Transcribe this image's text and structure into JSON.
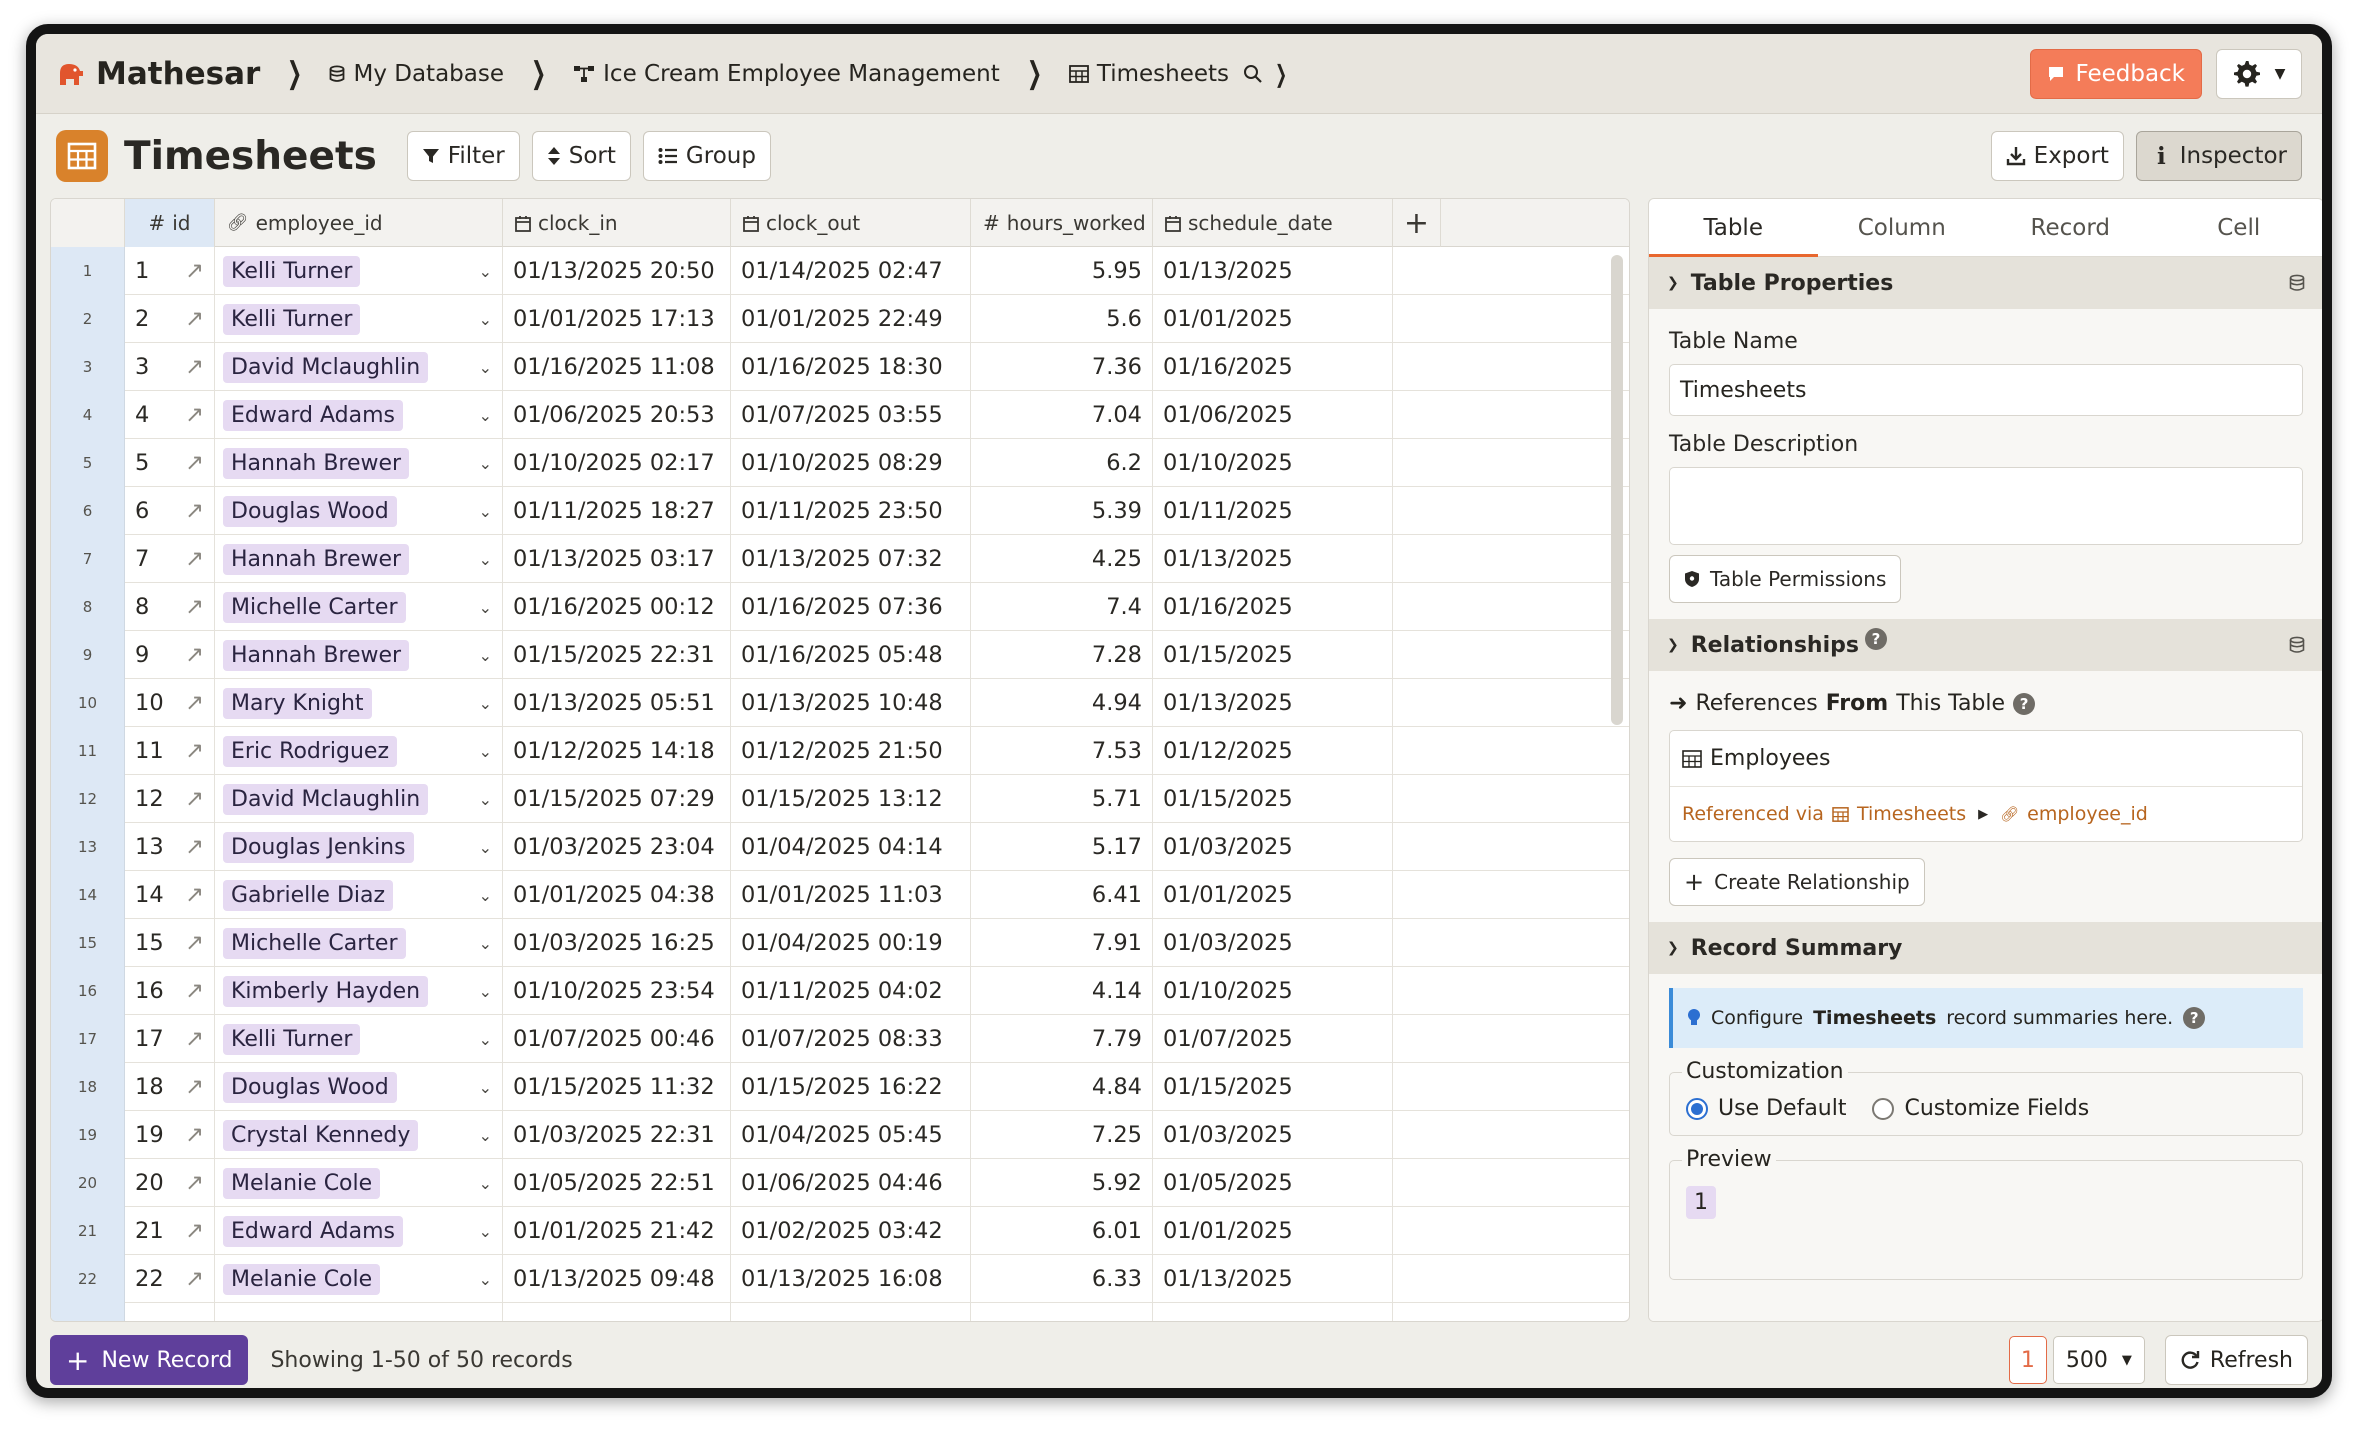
{
  "app": {
    "name": "Mathesar"
  },
  "breadcrumbs": [
    {
      "label": "My Database"
    },
    {
      "label": "Ice Cream Employee Management"
    },
    {
      "label": "Timesheets"
    }
  ],
  "header": {
    "feedback_label": "Feedback"
  },
  "title_bar": {
    "title": "Timesheets",
    "filter_label": "Filter",
    "sort_label": "Sort",
    "group_label": "Group",
    "export_label": "Export",
    "inspector_label": "Inspector"
  },
  "grid": {
    "columns": [
      "id",
      "employee_id",
      "clock_in",
      "clock_out",
      "hours_worked",
      "schedule_date"
    ],
    "rows": [
      {
        "n": "1",
        "id": "1",
        "emp": "Kelli Turner",
        "in": "01/13/2025 20:50",
        "out": "01/14/2025 02:47",
        "hrs": "5.95",
        "date": "01/13/2025"
      },
      {
        "n": "2",
        "id": "2",
        "emp": "Kelli Turner",
        "in": "01/01/2025 17:13",
        "out": "01/01/2025 22:49",
        "hrs": "5.6",
        "date": "01/01/2025"
      },
      {
        "n": "3",
        "id": "3",
        "emp": "David Mclaughlin",
        "in": "01/16/2025 11:08",
        "out": "01/16/2025 18:30",
        "hrs": "7.36",
        "date": "01/16/2025"
      },
      {
        "n": "4",
        "id": "4",
        "emp": "Edward Adams",
        "in": "01/06/2025 20:53",
        "out": "01/07/2025 03:55",
        "hrs": "7.04",
        "date": "01/06/2025"
      },
      {
        "n": "5",
        "id": "5",
        "emp": "Hannah Brewer",
        "in": "01/10/2025 02:17",
        "out": "01/10/2025 08:29",
        "hrs": "6.2",
        "date": "01/10/2025"
      },
      {
        "n": "6",
        "id": "6",
        "emp": "Douglas Wood",
        "in": "01/11/2025 18:27",
        "out": "01/11/2025 23:50",
        "hrs": "5.39",
        "date": "01/11/2025"
      },
      {
        "n": "7",
        "id": "7",
        "emp": "Hannah Brewer",
        "in": "01/13/2025 03:17",
        "out": "01/13/2025 07:32",
        "hrs": "4.25",
        "date": "01/13/2025"
      },
      {
        "n": "8",
        "id": "8",
        "emp": "Michelle Carter",
        "in": "01/16/2025 00:12",
        "out": "01/16/2025 07:36",
        "hrs": "7.4",
        "date": "01/16/2025"
      },
      {
        "n": "9",
        "id": "9",
        "emp": "Hannah Brewer",
        "in": "01/15/2025 22:31",
        "out": "01/16/2025 05:48",
        "hrs": "7.28",
        "date": "01/15/2025"
      },
      {
        "n": "10",
        "id": "10",
        "emp": "Mary Knight",
        "in": "01/13/2025 05:51",
        "out": "01/13/2025 10:48",
        "hrs": "4.94",
        "date": "01/13/2025"
      },
      {
        "n": "11",
        "id": "11",
        "emp": "Eric Rodriguez",
        "in": "01/12/2025 14:18",
        "out": "01/12/2025 21:50",
        "hrs": "7.53",
        "date": "01/12/2025"
      },
      {
        "n": "12",
        "id": "12",
        "emp": "David Mclaughlin",
        "in": "01/15/2025 07:29",
        "out": "01/15/2025 13:12",
        "hrs": "5.71",
        "date": "01/15/2025"
      },
      {
        "n": "13",
        "id": "13",
        "emp": "Douglas Jenkins",
        "in": "01/03/2025 23:04",
        "out": "01/04/2025 04:14",
        "hrs": "5.17",
        "date": "01/03/2025"
      },
      {
        "n": "14",
        "id": "14",
        "emp": "Gabrielle Diaz",
        "in": "01/01/2025 04:38",
        "out": "01/01/2025 11:03",
        "hrs": "6.41",
        "date": "01/01/2025"
      },
      {
        "n": "15",
        "id": "15",
        "emp": "Michelle Carter",
        "in": "01/03/2025 16:25",
        "out": "01/04/2025 00:19",
        "hrs": "7.91",
        "date": "01/03/2025"
      },
      {
        "n": "16",
        "id": "16",
        "emp": "Kimberly Hayden",
        "in": "01/10/2025 23:54",
        "out": "01/11/2025 04:02",
        "hrs": "4.14",
        "date": "01/10/2025"
      },
      {
        "n": "17",
        "id": "17",
        "emp": "Kelli Turner",
        "in": "01/07/2025 00:46",
        "out": "01/07/2025 08:33",
        "hrs": "7.79",
        "date": "01/07/2025"
      },
      {
        "n": "18",
        "id": "18",
        "emp": "Douglas Wood",
        "in": "01/15/2025 11:32",
        "out": "01/15/2025 16:22",
        "hrs": "4.84",
        "date": "01/15/2025"
      },
      {
        "n": "19",
        "id": "19",
        "emp": "Crystal Kennedy",
        "in": "01/03/2025 22:31",
        "out": "01/04/2025 05:45",
        "hrs": "7.25",
        "date": "01/03/2025"
      },
      {
        "n": "20",
        "id": "20",
        "emp": "Melanie Cole",
        "in": "01/05/2025 22:51",
        "out": "01/06/2025 04:46",
        "hrs": "5.92",
        "date": "01/05/2025"
      },
      {
        "n": "21",
        "id": "21",
        "emp": "Edward Adams",
        "in": "01/01/2025 21:42",
        "out": "01/02/2025 03:42",
        "hrs": "6.01",
        "date": "01/01/2025"
      },
      {
        "n": "22",
        "id": "22",
        "emp": "Melanie Cole",
        "in": "01/13/2025 09:48",
        "out": "01/13/2025 16:08",
        "hrs": "6.33",
        "date": "01/13/2025"
      }
    ]
  },
  "inspector": {
    "tabs": [
      "Table",
      "Column",
      "Record",
      "Cell"
    ],
    "table_properties": {
      "heading": "Table Properties",
      "name_label": "Table Name",
      "name_value": "Timesheets",
      "description_label": "Table Description",
      "permissions_label": "Table Permissions"
    },
    "relationships": {
      "heading": "Relationships",
      "refs_from_prefix": "References",
      "refs_from_bold": "From",
      "refs_from_suffix": "This Table",
      "card_table": "Employees",
      "referenced_via": "Referenced via",
      "via_table": "Timesheets",
      "via_column": "employee_id",
      "create_label": "Create Relationship"
    },
    "record_summary": {
      "heading": "Record Summary",
      "info_prefix": "Configure",
      "info_bold": "Timesheets",
      "info_suffix": "record summaries here.",
      "customization_label": "Customization",
      "option_default": "Use Default",
      "option_custom": "Customize Fields",
      "preview_label": "Preview",
      "preview_value": "1"
    }
  },
  "footer": {
    "new_record_label": "New Record",
    "showing_text": "Showing 1-50 of 50 records",
    "page": "1",
    "page_size": "500",
    "refresh_label": "Refresh"
  },
  "colors": {
    "accent": "#f47c59",
    "primary": "#5f3f9b",
    "table_icon": "#d9822b",
    "link_pill": "#e6daf2"
  }
}
